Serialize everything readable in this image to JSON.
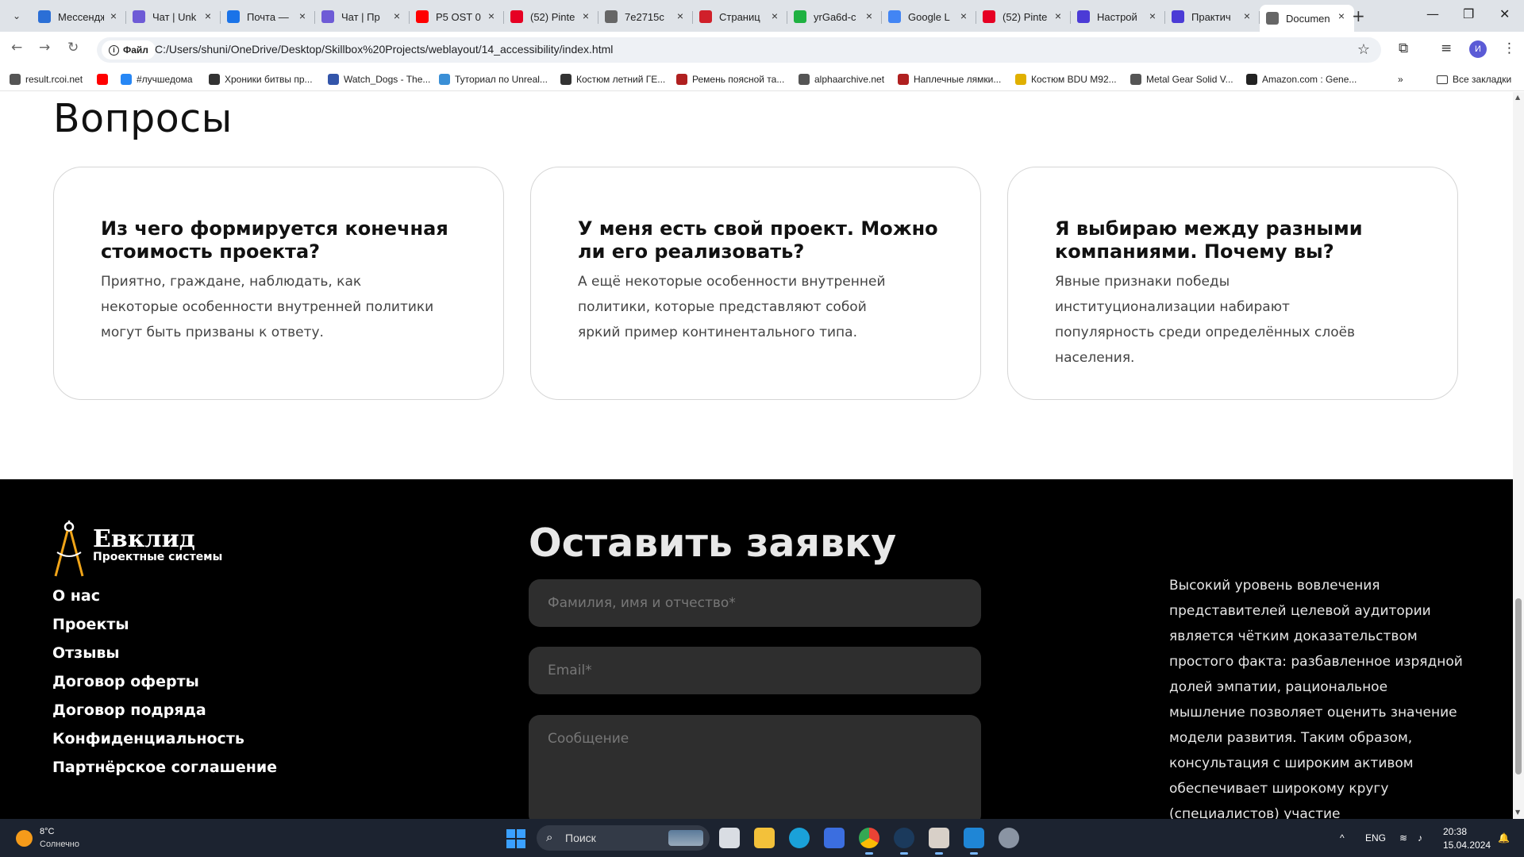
{
  "browser": {
    "tabs": [
      {
        "title": "Мессендж",
        "icon": "messenger-icon",
        "color": "#2b6fd6"
      },
      {
        "title": "Чат | Unk",
        "icon": "chat-icon",
        "color": "#6e5bd6"
      },
      {
        "title": "Почта — ",
        "icon": "mail-icon",
        "color": "#1a73e8"
      },
      {
        "title": "Чат | Пр",
        "icon": "chat-icon",
        "color": "#6e5bd6"
      },
      {
        "title": "P5 OST 0",
        "icon": "youtube-icon",
        "color": "#ff0000"
      },
      {
        "title": "(52) Pinte",
        "icon": "pinterest-icon",
        "color": "#e60023"
      },
      {
        "title": "7e2715c",
        "icon": "globe-icon",
        "color": "#666666"
      },
      {
        "title": "Страниц",
        "icon": "ud-icon",
        "color": "#d0202a"
      },
      {
        "title": "yrGa6d-c",
        "icon": "green-icon",
        "color": "#1fb141"
      },
      {
        "title": "Google L",
        "icon": "google-icon",
        "color": "#4285f4"
      },
      {
        "title": "(52) Pinte",
        "icon": "pinterest-icon",
        "color": "#e60023"
      },
      {
        "title": "Настрой",
        "icon": "s-icon",
        "color": "#4b3bd6"
      },
      {
        "title": "Практич",
        "icon": "s-icon",
        "color": "#4b3bd6"
      },
      {
        "title": "Documen",
        "icon": "globe-icon",
        "color": "#666666"
      }
    ],
    "file_chip": "Файл",
    "url": "C:/Users/shuni/OneDrive/Desktop/Skillbox%20Projects/weblayout/14_accessibility/index.html",
    "profile_initial": "И",
    "bookmarks": [
      {
        "label": "result.rcoi.net",
        "color": "#555555"
      },
      {
        "label": "",
        "color": "#ff0000"
      },
      {
        "label": "#лучшедома",
        "color": "#2787f5"
      },
      {
        "label": "Хроники битвы пр...",
        "color": "#333333"
      },
      {
        "label": "Watch_Dogs - The...",
        "color": "#3355aa"
      },
      {
        "label": "Туториал по Unreal...",
        "color": "#3a8fd6"
      },
      {
        "label": "Костюм летний ГЕ...",
        "color": "#333333"
      },
      {
        "label": "Ремень поясной та...",
        "color": "#b02020"
      },
      {
        "label": "alphaarchive.net",
        "color": "#555555"
      },
      {
        "label": "Наплечные лямки...",
        "color": "#b02020"
      },
      {
        "label": "Костюм BDU M92...",
        "color": "#e0b000"
      },
      {
        "label": "Metal Gear Solid V...",
        "color": "#555555"
      },
      {
        "label": "Amazon.com : Gene...",
        "color": "#222222"
      }
    ],
    "all_bookmarks": "Все закладки",
    "more_bookmarks": "»"
  },
  "page": {
    "faq_title": "Вопросы",
    "cards": [
      {
        "title": "Из чего формируется конечная стоимость проекта?",
        "text": "Приятно, граждане, наблюдать, как некоторые особенности внутренней политики могут быть призваны к ответу."
      },
      {
        "title": "У меня есть свой проект. Можно ли его реализовать?",
        "text": "А ещё некоторые особенности внутренней политики, которые представляют собой яркий пример континентального типа."
      },
      {
        "title": "Я выбираю между разными компаниями. Почему вы?",
        "text": "Явные признаки победы институционализации набирают популярность среди определённых слоёв населения."
      }
    ],
    "footer": {
      "logo_name": "Евклид",
      "logo_sub": "Проектные системы",
      "nav": [
        "О нас",
        "Проекты",
        "Отзывы",
        "Договор оферты",
        "Договор подряда",
        "Конфиденциальность",
        "Партнёрское соглашение"
      ],
      "form_title": "Оставить заявку",
      "name_placeholder": "Фамилия, имя и отчество*",
      "email_placeholder": "Email*",
      "message_placeholder": "Сообщение",
      "text": "Высокий уровень вовлечения представителей целевой аудитории является чётким доказательством простого факта: разбавленное изрядной долей эмпатии, рациональное мышление позволяет оценить значение модели развития. Таким образом, консультация с широким активом обеспечивает широкому кругу (специалистов) участие",
      "accent_color": "#f0a418"
    }
  },
  "taskbar": {
    "weather_temp": "8°C",
    "weather_desc": "Солнечно",
    "search_label": "Поиск",
    "lang": "ENG",
    "time": "20:38",
    "date": "15.04.2024"
  }
}
